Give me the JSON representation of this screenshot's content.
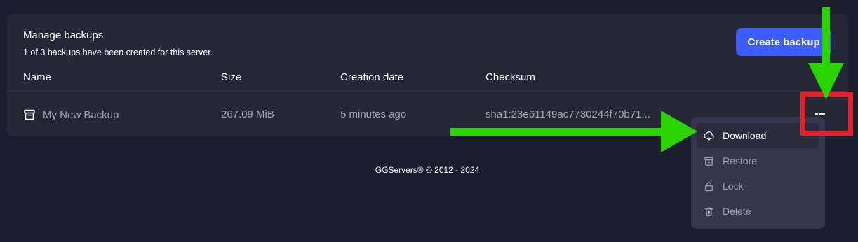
{
  "header": {
    "title": "Manage backups",
    "subtitle": "1 of 3 backups have been created for this server.",
    "create_button": "Create backup"
  },
  "table": {
    "columns": [
      "Name",
      "Size",
      "Creation date",
      "Checksum"
    ],
    "rows": [
      {
        "name": "My New Backup",
        "size": "267.09 MiB",
        "created": "5 minutes ago",
        "checksum": "sha1:23e61149ac7730244f70b71..."
      }
    ]
  },
  "menu": {
    "items": [
      {
        "label": "Download",
        "icon": "cloud-download-icon"
      },
      {
        "label": "Restore",
        "icon": "archive-restore-icon"
      },
      {
        "label": "Lock",
        "icon": "lock-icon"
      },
      {
        "label": "Delete",
        "icon": "trash-icon"
      }
    ]
  },
  "footer": {
    "text": "GGServers® © 2012 - 2024"
  },
  "colors": {
    "background": "#1b1d2e",
    "card": "#262838",
    "accent": "#3d5cff",
    "annotation_arrow": "#2ad400",
    "annotation_box": "#e4212b"
  }
}
